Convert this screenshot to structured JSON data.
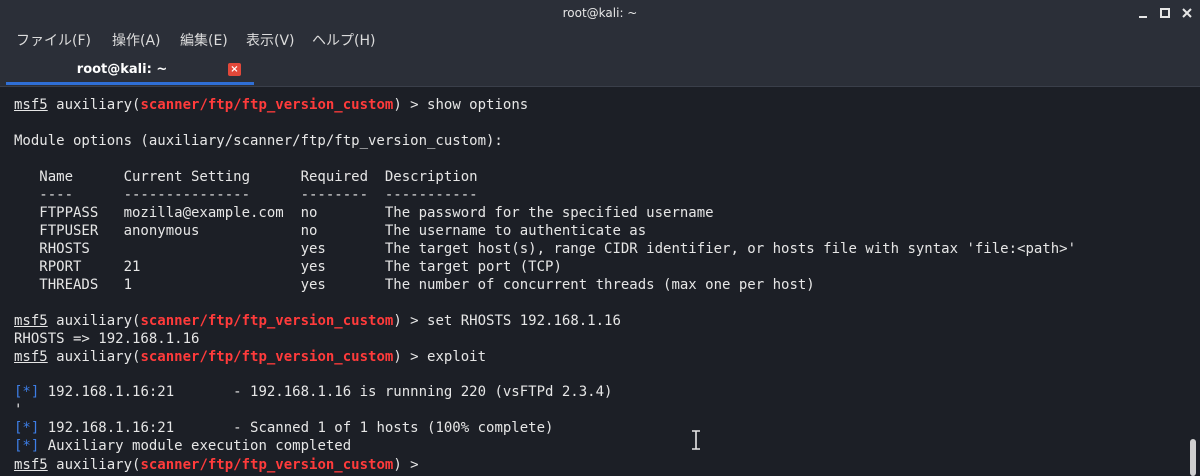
{
  "window": {
    "title": "root@kali: ~",
    "minimize_icon": "minimize-icon",
    "maximize_icon": "maximize-icon",
    "close_icon": "close-icon"
  },
  "menu": {
    "items": [
      {
        "label": "ファイル(F)"
      },
      {
        "label": "操作(A)"
      },
      {
        "label": "編集(E)"
      },
      {
        "label": "表示(V)"
      },
      {
        "label": "ヘルプ(H)"
      }
    ]
  },
  "tab": {
    "label": "root@kali: ~",
    "close_glyph": "×"
  },
  "colors": {
    "background": "#1c1f26",
    "chrome": "#2b2f38",
    "text": "#e6e6e6",
    "module_red": "#ff3b3b",
    "status_blue": "#3d7ee6",
    "tab_accent": "#2f6fd6",
    "tab_close": "#e2483a"
  },
  "terminal": {
    "prompt": {
      "msf": "msf5",
      "auxiliary_open": " auxiliary(",
      "module": "scanner/ftp/ftp_version_custom",
      "close_arrow": ") > "
    },
    "commands": {
      "show_options": "show options",
      "set_rhosts": "set RHOSTS 192.168.1.16",
      "exploit": "exploit"
    },
    "module_options_header": "Module options (auxiliary/scanner/ftp/ftp_version_custom):",
    "options_table": {
      "header": "   Name      Current Setting      Required  Description",
      "separator": "   ----      ---------------      --------  -----------",
      "rows": [
        "   FTPPASS   mozilla@example.com  no        The password for the specified username",
        "   FTPUSER   anonymous            no        The username to authenticate as",
        "   RHOSTS                         yes       The target host(s), range CIDR identifier, or hosts file with syntax 'file:<path>'",
        "   RPORT     21                   yes       The target port (TCP)",
        "   THREADS   1                    yes       The number of concurrent threads (max one per host)"
      ]
    },
    "rhosts_echo": "RHOSTS => 192.168.1.16",
    "status_marker": "[*]",
    "results": {
      "line1": " 192.168.1.16:21       - 192.168.1.16 is runnning 220 (vsFTPd 2.3.4)",
      "line2": " 192.168.1.16:21       - Scanned 1 of 1 hosts (100% complete)",
      "line3": " Auxiliary module execution completed"
    }
  }
}
